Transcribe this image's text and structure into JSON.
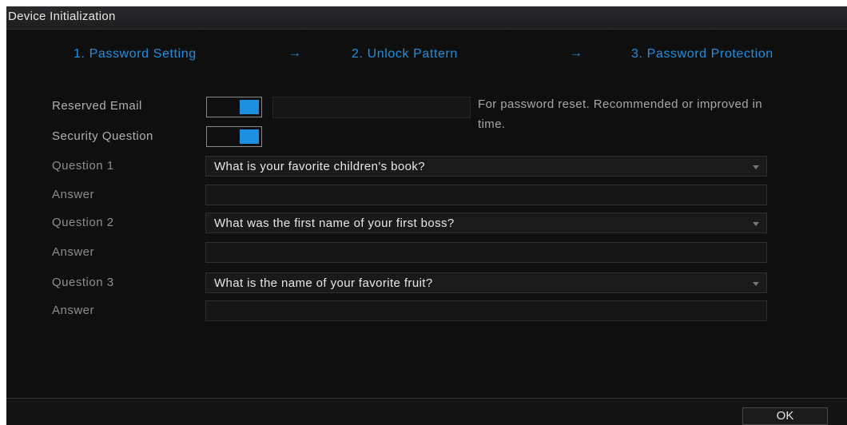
{
  "window": {
    "title": "Device Initialization"
  },
  "steps": [
    {
      "label": "1. Password Setting"
    },
    {
      "label": "2. Unlock Pattern"
    },
    {
      "label": "3. Password Protection"
    }
  ],
  "step_arrow": "→",
  "colors": {
    "accent": "#1f8fe0",
    "toggle_on": "#1d8fe1",
    "background": "#0f0f10"
  },
  "form": {
    "reserved_email": {
      "label": "Reserved Email",
      "enabled": true,
      "value": ""
    },
    "security_question": {
      "label": "Security Question",
      "enabled": true
    },
    "hint": "For password reset. Recommended or improved in time.",
    "questions": [
      {
        "label": "Question 1",
        "selected": "What is your favorite children's book?",
        "answer_label": "Answer",
        "answer_value": ""
      },
      {
        "label": "Question 2",
        "selected": "What was the first name of your first boss?",
        "answer_label": "Answer",
        "answer_value": ""
      },
      {
        "label": "Question 3",
        "selected": "What is the name of your favorite fruit?",
        "answer_label": "Answer",
        "answer_value": ""
      }
    ]
  },
  "footer": {
    "ok_label": "OK"
  }
}
